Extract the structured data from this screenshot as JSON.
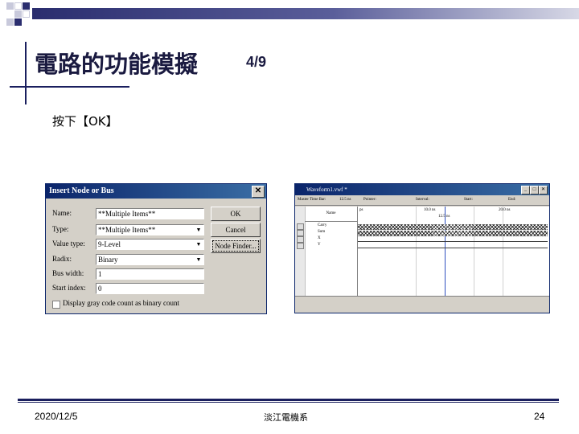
{
  "slide": {
    "title": "電路的功能模擬",
    "page_indicator": "4/9",
    "instruction": "按下【OK】",
    "accent_colors": [
      "#1a1f5e",
      "#2a2d6e",
      "#d7d8e6"
    ]
  },
  "dialog": {
    "title": "Insert Node or Bus",
    "close_icon": "close-icon",
    "fields": [
      {
        "label": "Name:",
        "value": "**Multiple Items**",
        "dropdown": false
      },
      {
        "label": "Type:",
        "value": "**Multiple Items**",
        "dropdown": true
      },
      {
        "label": "Value type:",
        "value": "9-Level",
        "dropdown": true
      },
      {
        "label": "Radix:",
        "value": "Binary",
        "dropdown": true
      },
      {
        "label": "Bus width:",
        "value": "1",
        "dropdown": false
      },
      {
        "label": "Start index:",
        "value": "0",
        "dropdown": false
      }
    ],
    "buttons": {
      "ok": "OK",
      "cancel": "Cancel",
      "node_finder": "Node Finder..."
    },
    "checkbox_label": "Display gray code count as binary count"
  },
  "waveform": {
    "title": "Waveform1.vwf *",
    "toolbar": {
      "master_label": "Master Time Bar:",
      "master_value": "12.5 ns",
      "pointer_label": "Pointer:",
      "interval_label": "Interval:",
      "start_label": "Start:",
      "end_label": "End:"
    },
    "name_header": "Name",
    "time_marks": [
      "ps",
      "10.0 ns",
      "20.0 ns"
    ],
    "master_marker": "12.5 ns",
    "signals": [
      "Carry",
      "Sum",
      "X",
      "Y"
    ]
  },
  "footer": {
    "date": "2020/12/5",
    "org": "淡江電機系",
    "page_number": "24"
  }
}
